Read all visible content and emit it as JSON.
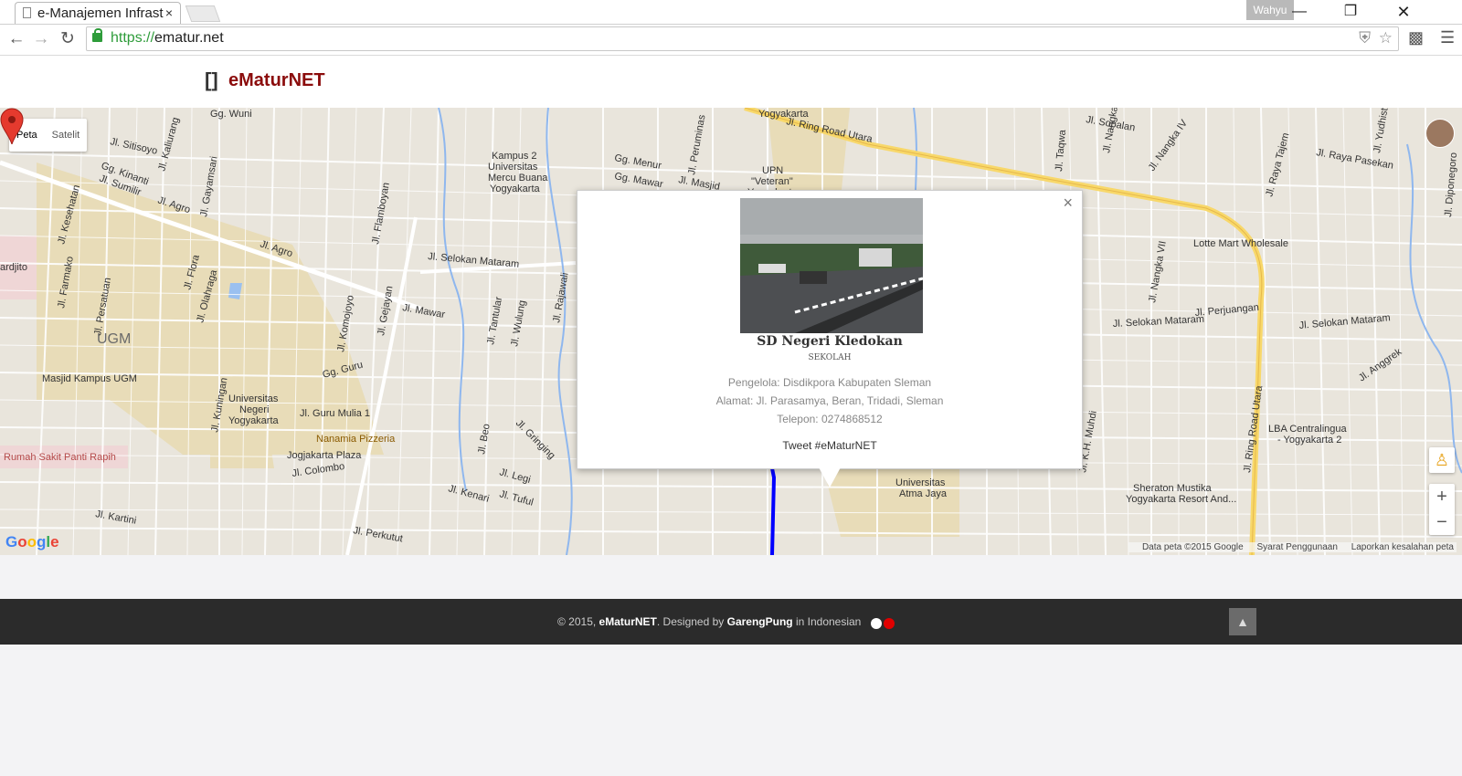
{
  "browser": {
    "tab_title": "e-Manajemen Infrast",
    "tab_close": "×",
    "profile_name": "Wahyu",
    "url_scheme": "https://",
    "url_host": "ematur.net",
    "window_controls": [
      "minimize-icon",
      "restore-icon",
      "close-icon"
    ]
  },
  "header": {
    "logo_glyph": "[]",
    "brand": "eMaturNET"
  },
  "map": {
    "type_controls": [
      "Peta",
      "Satelit"
    ],
    "active_type": "Peta",
    "zoom_in": "+",
    "zoom_out": "−",
    "google_logo": "Google",
    "attribution": [
      "Data peta ©2015 Google",
      "Syarat Penggunaan",
      "Laporkan kesalahan peta"
    ],
    "labels": [
      {
        "text": "Jl. Ring Road Utara"
      },
      {
        "text": "Kampus 2"
      },
      {
        "text": "Universitas"
      },
      {
        "text": "Mercu Buana"
      },
      {
        "text": "Yogyakarta"
      },
      {
        "text": "UPN"
      },
      {
        "text": "\"Veteran\""
      },
      {
        "text": "Yogyakarta"
      },
      {
        "text": "Gg. Menur"
      },
      {
        "text": "Gg. Mawar"
      },
      {
        "text": "Jl. Masjid"
      },
      {
        "text": "Jl. Sopalan"
      },
      {
        "text": "Jl. Raya Pasekan"
      },
      {
        "text": "Jl. Yudhistira"
      },
      {
        "text": "Lotte Mart Wholesale"
      },
      {
        "text": "Jl. Selokan Mataram"
      },
      {
        "text": "Jl. Perjuangan"
      },
      {
        "text": "Jl. Selokan Mataram"
      },
      {
        "text": "Jl. Anggrek"
      },
      {
        "text": "LBA Centralingua"
      },
      {
        "text": "- Yogyakarta 2"
      },
      {
        "text": "Sheraton Mustika"
      },
      {
        "text": "Yogyakarta Resort And..."
      },
      {
        "text": "Jl. K.H. Muhdi"
      },
      {
        "text": "Jl. Ring Road Utara"
      },
      {
        "text": "Universitas"
      },
      {
        "text": "Atma Jaya"
      },
      {
        "text": "Gg. Wuni"
      },
      {
        "text": "Jl. Sitisoyo"
      },
      {
        "text": "Gg. Kinanti"
      },
      {
        "text": "Jl. Sumilir"
      },
      {
        "text": "Jl. Agro"
      },
      {
        "text": "Jl. Agro"
      },
      {
        "text": "ardjito"
      },
      {
        "text": "UGM"
      },
      {
        "text": "Masjid Kampus UGM"
      },
      {
        "text": "Universitas"
      },
      {
        "text": "Negeri"
      },
      {
        "text": "Yogyakarta"
      },
      {
        "text": "Jl. Mawar"
      },
      {
        "text": "Jl. Selokan Mataram"
      },
      {
        "text": "Gg. Guru"
      },
      {
        "text": "Jl. Guru Mulia 1"
      },
      {
        "text": "Nanamia Pizzeria"
      },
      {
        "text": "Jogjakarta Plaza"
      },
      {
        "text": "Rumah Sakit Panti Rapih"
      },
      {
        "text": "Jl. Colombo"
      },
      {
        "text": "Jl. Kenari"
      },
      {
        "text": "Jl. Legi"
      },
      {
        "text": "Jl. Tuful"
      },
      {
        "text": "Jl. Kartini"
      },
      {
        "text": "Jl. Perkutut"
      },
      {
        "text": "Jl. Gejayan"
      },
      {
        "text": "Jl. Kaliurang"
      },
      {
        "text": "Jl. Persatuan"
      },
      {
        "text": "Jl. Farmako"
      },
      {
        "text": "Jl. Flora"
      },
      {
        "text": "Jl. Olahraga"
      },
      {
        "text": "Jl. Tantular"
      },
      {
        "text": "Jl. Wulung"
      },
      {
        "text": "Jl. Rajawali"
      },
      {
        "text": "Jl. Nangka II"
      },
      {
        "text": "Jl. Nangka IV"
      },
      {
        "text": "Jl. Nangka VII"
      },
      {
        "text": "Jl. Taqwa"
      },
      {
        "text": "Jl. Raya Tajem"
      },
      {
        "text": "Jl. Diponegoro"
      },
      {
        "text": "Jl. Beo"
      },
      {
        "text": "Jl. Gringing"
      },
      {
        "text": "Jl. Kesehatan"
      },
      {
        "text": "Jl. Gayamsari"
      },
      {
        "text": "Jl. Flamboyan"
      },
      {
        "text": "Jl. Komojoyo"
      },
      {
        "text": "Jl. Kuningan"
      },
      {
        "text": "Yogyakarta"
      },
      {
        "text": "Jl. Peruminas"
      }
    ]
  },
  "infowindow": {
    "close": "×",
    "name": "SD Negeri Kledokan",
    "category": "SEKOLAH",
    "pengelola": "Pengelola: Disdikpora Kabupaten Sleman",
    "alamat": "Alamat: Jl. Parasamya, Beran, Tridadi, Sleman",
    "telepon": "Telepon: 0274868512",
    "tweet": "Tweet #eMaturNET"
  },
  "footer": {
    "copyright": "© 2015, ",
    "brand": "eMaturNET",
    "designed_by": ". Designed by ",
    "designer": "GarengPung",
    "lang_prefix": " in ",
    "language": "Indonesian",
    "flag_colors": [
      "#ffffff",
      "#e00000"
    ],
    "to_top": "▲"
  },
  "colors": {
    "brand": "#8b0c0c",
    "route": "#0000ff",
    "ring_road": "#f8d86a",
    "footer_bg": "#2b2b2b"
  }
}
